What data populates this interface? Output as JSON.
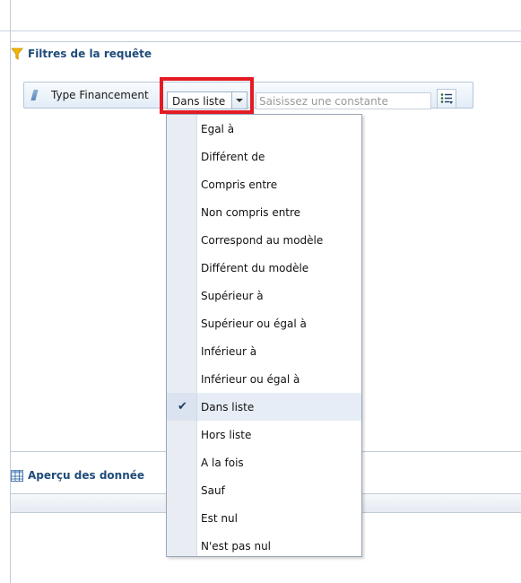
{
  "filters_panel": {
    "title": "Filtres de la requête",
    "filter": {
      "field_name": "Type Financement",
      "operator": "Dans liste",
      "constant_placeholder": "Saisissez une constante"
    }
  },
  "preview_panel": {
    "title": "Aperçu des donnée"
  },
  "operator_menu": {
    "selected": "Dans liste",
    "items": [
      "Egal à",
      "Différent de",
      "Compris entre",
      "Non compris entre",
      "Correspond au modèle",
      "Différent du modèle",
      "Supérieur à",
      "Supérieur ou égal à",
      "Inférieur à",
      "Inférieur ou égal à",
      "Dans liste",
      "Hors liste",
      "A la fois",
      "Sauf",
      "Est nul",
      "N'est pas nul"
    ]
  },
  "colors": {
    "highlight": "#e31b23",
    "header_text": "#1f4c7a",
    "filter_icon": "#f2b705"
  }
}
